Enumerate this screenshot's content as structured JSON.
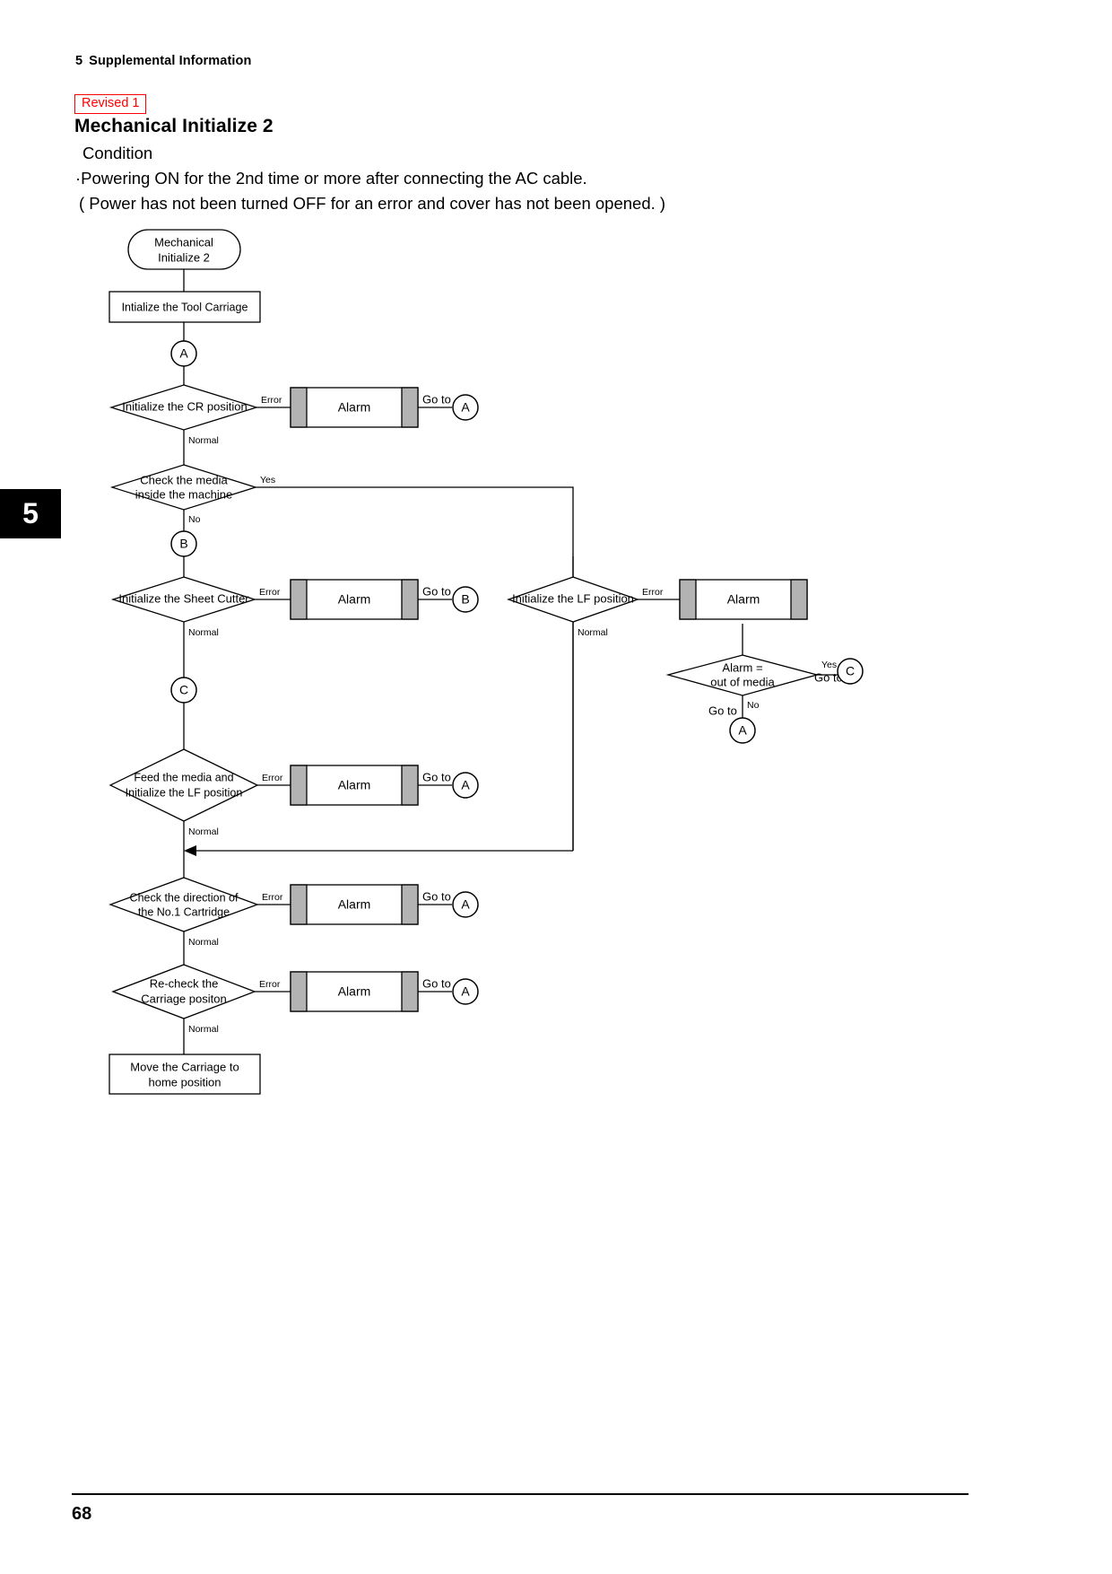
{
  "header": {
    "chapter_number": "5",
    "chapter_title": "Supplemental Information"
  },
  "revised_badge": {
    "label": "Revised 1",
    "color": "#ff0000"
  },
  "title": "Mechanical Initialize 2",
  "condition": {
    "label": "Condition",
    "lines": [
      "·Powering ON for the 2nd time or more after connecting the AC cable.",
      "( Power has not been turned OFF for an error and cover has not been opened. )"
    ]
  },
  "chapter_tab": "5",
  "footer": {
    "page_number": "68"
  },
  "flowchart": {
    "terminator": {
      "line1": "Mechanical",
      "line2": "Initialize 2"
    },
    "process_top": "Intialize the Tool Carriage",
    "process_bottom": {
      "line1": "Move the Carriage to",
      "line2": "home position"
    },
    "connectors": {
      "a_top": "A",
      "b": "B",
      "c": "C",
      "alarm1_target": "A",
      "alarm2_target": "B",
      "alarm3_target": "A",
      "alarm4_target": "A",
      "alarm5_target": "A",
      "media_yes_target": "C",
      "media_no_target": "A"
    },
    "decisions": {
      "cr_position": {
        "line1": "Initialize the CR position",
        "line2": ""
      },
      "check_media": {
        "line1": "Check the media",
        "line2": "inside the machine"
      },
      "sheet_cutter": {
        "line1": "Initialize the Sheet Cutter",
        "line2": ""
      },
      "lf_position": {
        "line1": "Initialize the LF position",
        "line2": ""
      },
      "out_of_media": {
        "line1": "Alarm =",
        "line2": "out of media"
      },
      "feed_media": {
        "line1": "Feed the media and",
        "line2": "Initialize the LF position"
      },
      "cartridge_direction": {
        "line1": "Check the direction of",
        "line2": "the No.1 Cartridge"
      },
      "recheck_carriage": {
        "line1": "Re-check the",
        "line2": "Carriage positon"
      }
    },
    "alarm_label": "Alarm",
    "edge_labels": {
      "error": "Error",
      "normal": "Normal",
      "yes": "Yes",
      "no": "No",
      "go_to": "Go to"
    },
    "colors": {
      "alarm_bar": "#b3b3b3",
      "stroke": "#000000",
      "fill": "#ffffff"
    }
  }
}
